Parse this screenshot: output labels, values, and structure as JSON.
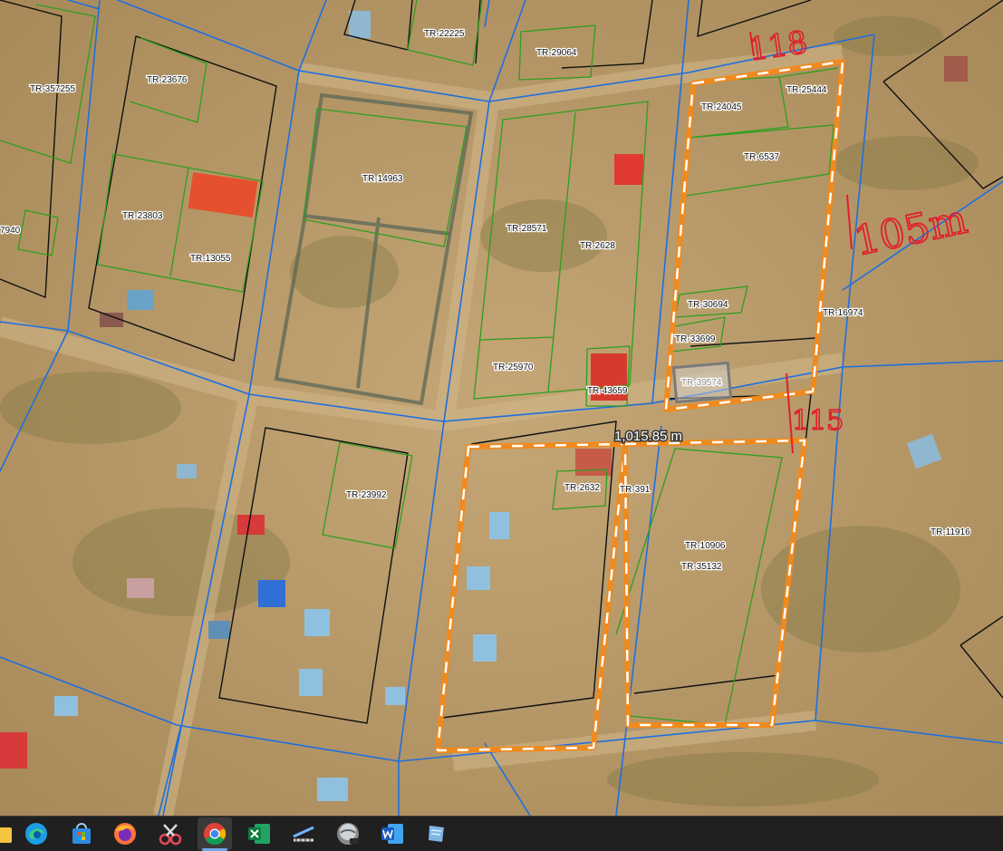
{
  "parcels": [
    {
      "id": "p_357255",
      "label": "TR-357255"
    },
    {
      "id": "p_23676",
      "label": "TR-23676"
    },
    {
      "id": "p_22225",
      "label": "TR-22225"
    },
    {
      "id": "p_29064",
      "label": "TR-29064"
    },
    {
      "id": "p_24045",
      "label": "TR-24045"
    },
    {
      "id": "p_25444",
      "label": "TR-25444"
    },
    {
      "id": "p_6537",
      "label": "TR-6537"
    },
    {
      "id": "p_14963",
      "label": "TR-14963"
    },
    {
      "id": "p_23803",
      "label": "TR-23803"
    },
    {
      "id": "p_7940",
      "label": "7940"
    },
    {
      "id": "p_13055",
      "label": "TR-13055"
    },
    {
      "id": "p_28571",
      "label": "TR-28571"
    },
    {
      "id": "p_2628",
      "label": "TR-2628"
    },
    {
      "id": "p_30694",
      "label": "TR-30694"
    },
    {
      "id": "p_16974",
      "label": "TR-16974"
    },
    {
      "id": "p_33699",
      "label": "TR-33699"
    },
    {
      "id": "p_25970",
      "label": "TR-25970"
    },
    {
      "id": "p_39574",
      "label": "TR-39574"
    },
    {
      "id": "p_43659",
      "label": "TR-43659"
    },
    {
      "id": "p_23992",
      "label": "TR-23992"
    },
    {
      "id": "p_2632",
      "label": "TR-2632"
    },
    {
      "id": "p_391",
      "label": "TR-391"
    },
    {
      "id": "p_10906",
      "label": "TR-10906"
    },
    {
      "id": "p_35132",
      "label": "TR-35132"
    },
    {
      "id": "p_11916",
      "label": "TR-11916"
    }
  ],
  "measurement": {
    "text": "1,015.85 m"
  },
  "annotations": {
    "top": "118",
    "side": "105m",
    "bottom": "115"
  },
  "colors": {
    "ground": "#b89a6a",
    "cadastre_blue": "#1e6fe0",
    "parcel_green": "#2f9e1f",
    "parcel_black": "#111111",
    "highlight_orange": "#f08a1e",
    "handwriting_red": "#e0202a",
    "taskbar": "#202020"
  },
  "taskbar": {
    "items": [
      {
        "icon": "file-explorer-icon",
        "active": false
      },
      {
        "icon": "edge-browser-icon",
        "active": false
      },
      {
        "icon": "microsoft-store-icon",
        "active": false
      },
      {
        "icon": "firefox-icon",
        "active": false
      },
      {
        "icon": "snipping-tool-icon",
        "active": false
      },
      {
        "icon": "chrome-icon",
        "active": true
      },
      {
        "icon": "excel-icon",
        "active": false
      },
      {
        "icon": "measure-tool-icon",
        "active": false
      },
      {
        "icon": "arcgis-pro-icon",
        "active": false
      },
      {
        "icon": "word-icon",
        "active": false
      },
      {
        "icon": "notes-app-icon",
        "active": false
      }
    ]
  }
}
